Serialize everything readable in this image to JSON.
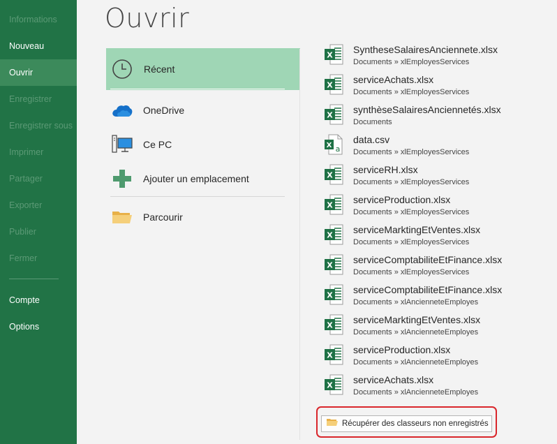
{
  "sidebar": {
    "items": [
      {
        "label": "Informations",
        "state": "disabled"
      },
      {
        "label": "Nouveau",
        "state": "normal"
      },
      {
        "label": "Ouvrir",
        "state": "active"
      },
      {
        "label": "Enregistrer",
        "state": "disabled"
      },
      {
        "label": "Enregistrer sous",
        "state": "disabled"
      },
      {
        "label": "Imprimer",
        "state": "disabled"
      },
      {
        "label": "Partager",
        "state": "disabled"
      },
      {
        "label": "Exporter",
        "state": "disabled"
      },
      {
        "label": "Publier",
        "state": "disabled"
      },
      {
        "label": "Fermer",
        "state": "disabled"
      },
      {
        "label": "Compte",
        "state": "normal"
      },
      {
        "label": "Options",
        "state": "normal"
      }
    ]
  },
  "main": {
    "title": "Ouvrir",
    "locations": [
      {
        "label": "Récent",
        "icon": "clock-icon",
        "selected": true
      },
      {
        "label": "OneDrive",
        "icon": "onedrive-cloud-icon"
      },
      {
        "label": "Ce PC",
        "icon": "computer-icon"
      },
      {
        "label": "Ajouter un emplacement",
        "icon": "plus-icon"
      },
      {
        "label": "Parcourir",
        "icon": "folder-icon"
      }
    ],
    "files": [
      {
        "name": "SyntheseSalairesAnciennete.xlsx",
        "path": "Documents » xlEmployesServices",
        "icon": "excel-icon"
      },
      {
        "name": "serviceAchats.xlsx",
        "path": "Documents » xlEmployesServices",
        "icon": "excel-icon"
      },
      {
        "name": "synthèseSalairesAnciennetés.xlsx",
        "path": "Documents",
        "icon": "excel-icon"
      },
      {
        "name": "data.csv",
        "path": "Documents » xlEmployesServices",
        "icon": "csv-icon"
      },
      {
        "name": "serviceRH.xlsx",
        "path": "Documents » xlEmployesServices",
        "icon": "excel-icon"
      },
      {
        "name": "serviceProduction.xlsx",
        "path": "Documents » xlEmployesServices",
        "icon": "excel-icon"
      },
      {
        "name": "serviceMarktingEtVentes.xlsx",
        "path": "Documents » xlEmployesServices",
        "icon": "excel-icon"
      },
      {
        "name": "serviceComptabiliteEtFinance.xlsx",
        "path": "Documents » xlEmployesServices",
        "icon": "excel-icon"
      },
      {
        "name": "serviceComptabiliteEtFinance.xlsx",
        "path": "Documents » xlAncienneteEmployes",
        "icon": "excel-icon"
      },
      {
        "name": "serviceMarktingEtVentes.xlsx",
        "path": "Documents » xlAncienneteEmployes",
        "icon": "excel-icon"
      },
      {
        "name": "serviceProduction.xlsx",
        "path": "Documents » xlAncienneteEmployes",
        "icon": "excel-icon"
      },
      {
        "name": "serviceAchats.xlsx",
        "path": "Documents » xlAncienneteEmployes",
        "icon": "excel-icon"
      }
    ],
    "recover_button": {
      "label": "Récupérer des classeurs non enregistrés",
      "icon": "folder-open-icon"
    }
  },
  "colors": {
    "sidebar_bg": "#217346",
    "sidebar_active": "#3c8a5b",
    "selected_location": "#9fd6b5",
    "highlight_frame": "#d9262b"
  }
}
